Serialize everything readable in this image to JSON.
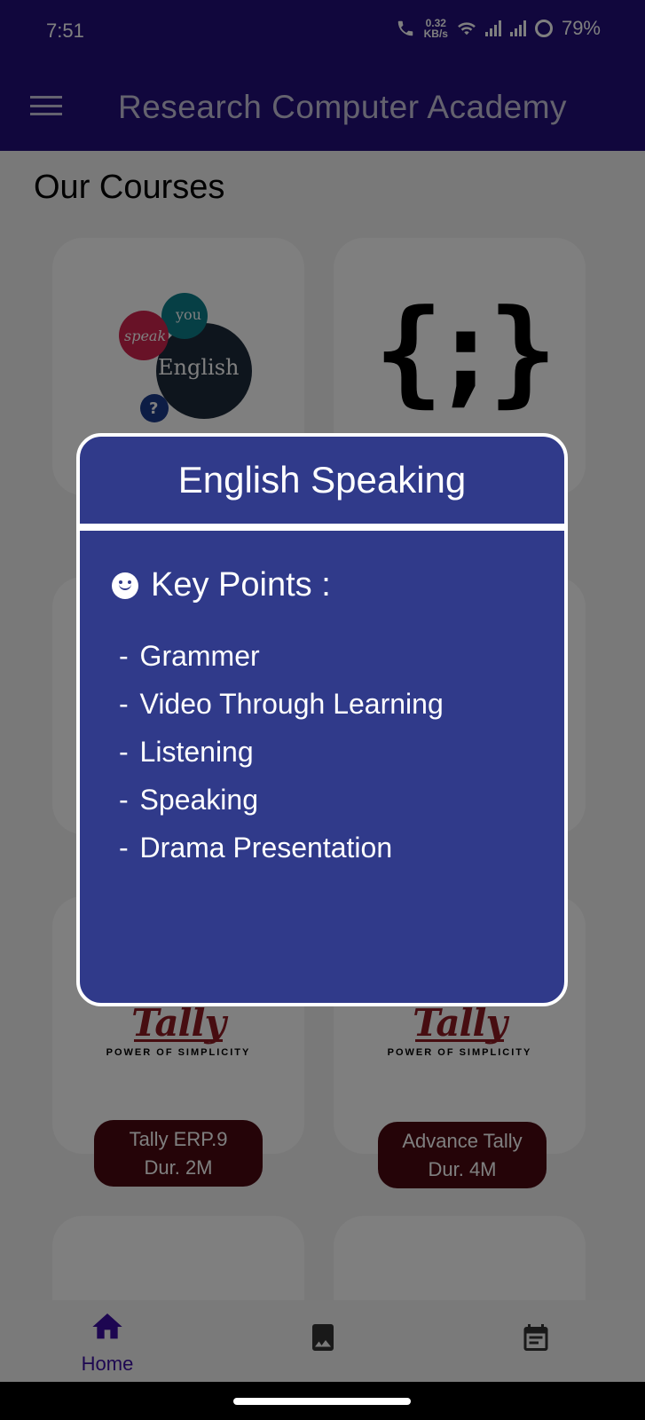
{
  "status_bar": {
    "time": "7:51",
    "net_speed": "0.32",
    "net_unit": "KB/s",
    "battery": "79%"
  },
  "app_bar": {
    "title": "Research Computer Academy"
  },
  "page": {
    "title": "Our Courses"
  },
  "cards": [
    {
      "course": "Tally ERP.9",
      "duration": "Dur. 2M",
      "logo_text": "Tally",
      "tagline": "POWER OF SIMPLICITY"
    },
    {
      "course": "Advance Tally",
      "duration": "Dur. 4M",
      "logo_text": "Tally",
      "tagline": "POWER OF SIMPLICITY"
    }
  ],
  "english_logo": {
    "speak": "speak",
    "you": "you",
    "english": "English",
    "q": "?"
  },
  "code_logo": "{;}",
  "dialog": {
    "title": "English Speaking",
    "key_points_label": "Key Points :",
    "points": [
      "Grammer",
      "Video Through Learning",
      "Listening",
      "Speaking",
      "Drama Presentation"
    ]
  },
  "bottom_nav": {
    "home_label": "Home"
  },
  "colors": {
    "primary": "#230f7a",
    "dialog_bg": "#303a8a",
    "pill_bg": "#4a0810",
    "tally_red": "#8e1a22"
  },
  "icons": [
    "menu-icon",
    "home-icon",
    "gallery-icon",
    "calendar-icon",
    "smiley-icon"
  ]
}
